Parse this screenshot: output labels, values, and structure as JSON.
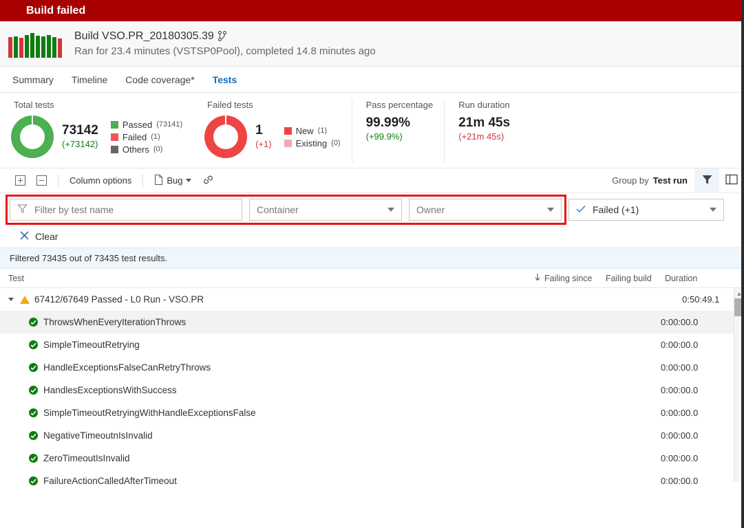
{
  "banner": {
    "title": "Build failed"
  },
  "build": {
    "name": "Build VSO.PR_20180305.39",
    "branch_icon": "branch-icon",
    "subtitle": "Ran for 23.4 minutes (VSTSP0Pool), completed 14.8 minutes ago",
    "sparkline": {
      "colors": [
        "#d13438",
        "#107c10",
        "#d13438",
        "#107c10",
        "#107c10",
        "#107c10",
        "#107c10",
        "#107c10",
        "#107c10",
        "#d13438"
      ],
      "heights": [
        30,
        31,
        29,
        33,
        36,
        32,
        31,
        33,
        30,
        28
      ]
    }
  },
  "tabs": [
    {
      "label": "Summary",
      "active": false
    },
    {
      "label": "Timeline",
      "active": false
    },
    {
      "label": "Code coverage*",
      "active": false
    },
    {
      "label": "Tests",
      "active": true
    }
  ],
  "metrics": {
    "total_tests": {
      "label": "Total tests",
      "value": "73142",
      "delta": "(+73142)",
      "delta_color": "#107c10",
      "donut_color": "#4caf50",
      "legend": [
        {
          "label": "Passed",
          "count": "(73141)",
          "color": "#4caf50"
        },
        {
          "label": "Failed",
          "count": "(1)",
          "color": "#f2545b"
        },
        {
          "label": "Others",
          "count": "(0)",
          "color": "#666666"
        }
      ]
    },
    "failed_tests": {
      "label": "Failed tests",
      "value": "1",
      "delta": "(+1)",
      "delta_color": "#d13438",
      "donut_color": "#ef4444",
      "legend": [
        {
          "label": "New",
          "count": "(1)",
          "color": "#ef4444"
        },
        {
          "label": "Existing",
          "count": "(0)",
          "color": "#f4a9a9"
        }
      ]
    },
    "pass_percentage": {
      "label": "Pass percentage",
      "value": "99.99%",
      "delta": "(+99.9%)",
      "delta_color": "#107c10"
    },
    "run_duration": {
      "label": "Run duration",
      "value": "21m 45s",
      "delta": "(+21m 45s)",
      "delta_color": "#d13438"
    }
  },
  "toolbar": {
    "expand_icon": "expand-all-icon",
    "collapse_icon": "collapse-all-icon",
    "column_options_label": "Column options",
    "bug_label": "Bug",
    "bug_icon": "bug-file-icon",
    "link_icon": "link-icon",
    "group_by_label": "Group by",
    "group_by_value": "Test run",
    "filter_icon": "funnel-icon",
    "panel_icon": "side-panel-icon"
  },
  "filters": {
    "search_placeholder": "Filter by test name",
    "search_value": "",
    "search_icon": "funnel-icon",
    "container_label": "Container",
    "owner_label": "Owner",
    "outcome_label": "Failed (+1)",
    "outcome_check_icon": "check-icon",
    "clear_label": "Clear",
    "clear_icon": "close-x-icon",
    "highlight_color": "#ee1111"
  },
  "filtered_summary": "Filtered 73435 out of 73435 test results.",
  "table": {
    "columns": {
      "test": "Test",
      "failing_since": "Failing since",
      "failing_build": "Failing build",
      "duration": "Duration",
      "sort_icon": "sort-down-arrow-icon"
    },
    "rows": [
      {
        "type": "group",
        "icon": "warning-triangle-icon",
        "caret": "chevron-down-icon",
        "name": "67412/67649 Passed - L0 Run - VSO.PR",
        "failing_since": "",
        "failing_build": "",
        "duration": "0:50:49.1",
        "selected": false
      },
      {
        "type": "test",
        "icon": "pass-check-icon",
        "name": "ThrowsWhenEveryIterationThrows",
        "failing_since": "",
        "failing_build": "",
        "duration": "0:00:00.0",
        "selected": true
      },
      {
        "type": "test",
        "icon": "pass-check-icon",
        "name": "SimpleTimeoutRetrying",
        "failing_since": "",
        "failing_build": "",
        "duration": "0:00:00.0",
        "selected": false
      },
      {
        "type": "test",
        "icon": "pass-check-icon",
        "name": "HandleExceptionsFalseCanRetryThrows",
        "failing_since": "",
        "failing_build": "",
        "duration": "0:00:00.0",
        "selected": false
      },
      {
        "type": "test",
        "icon": "pass-check-icon",
        "name": "HandlesExceptionsWithSuccess",
        "failing_since": "",
        "failing_build": "",
        "duration": "0:00:00.0",
        "selected": false
      },
      {
        "type": "test",
        "icon": "pass-check-icon",
        "name": "SimpleTimeoutRetryingWithHandleExceptionsFalse",
        "failing_since": "",
        "failing_build": "",
        "duration": "0:00:00.0",
        "selected": false
      },
      {
        "type": "test",
        "icon": "pass-check-icon",
        "name": "NegativeTimeoutnIsInvalid",
        "failing_since": "",
        "failing_build": "",
        "duration": "0:00:00.0",
        "selected": false
      },
      {
        "type": "test",
        "icon": "pass-check-icon",
        "name": "ZeroTimeoutIsInvalid",
        "failing_since": "",
        "failing_build": "",
        "duration": "0:00:00.0",
        "selected": false
      },
      {
        "type": "test",
        "icon": "pass-check-icon",
        "name": "FailureActionCalledAfterTimeout",
        "failing_since": "",
        "failing_build": "",
        "duration": "0:00:00.0",
        "selected": false
      }
    ]
  }
}
